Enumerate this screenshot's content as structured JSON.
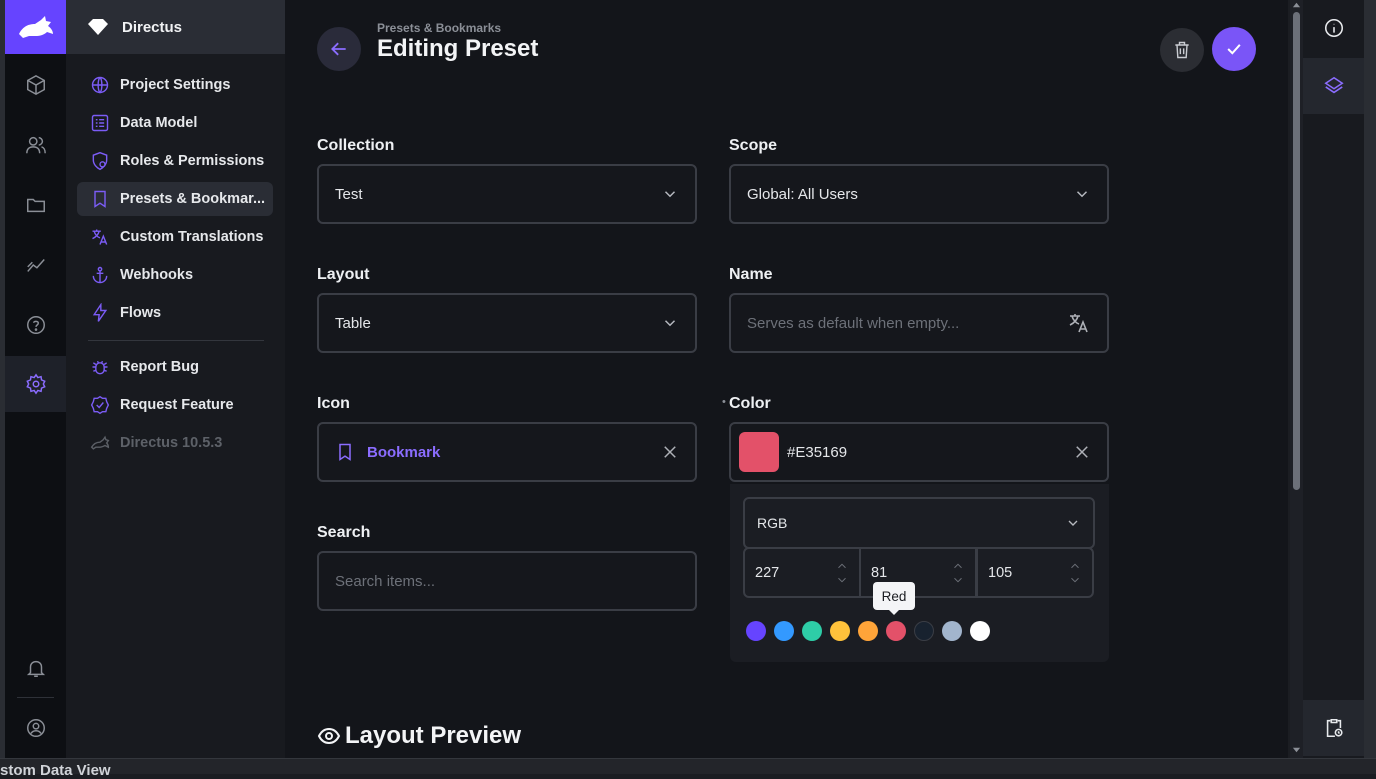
{
  "app": {
    "name": "Directus",
    "version": "Directus 10.5.3"
  },
  "colors": {
    "accent": "#6644ff",
    "selected_color": "#E35169"
  },
  "module_bar": {
    "items": [
      "content-icon",
      "users-icon",
      "files-icon",
      "insights-icon",
      "help-icon",
      "settings-icon"
    ],
    "bottom": [
      "bell-icon",
      "user-icon"
    ]
  },
  "nav": {
    "items": [
      {
        "label": "Project Settings",
        "icon": "globe-icon"
      },
      {
        "label": "Data Model",
        "icon": "list-icon"
      },
      {
        "label": "Roles & Permissions",
        "icon": "shield-icon"
      },
      {
        "label": "Presets & Bookmar...",
        "icon": "bookmark-icon"
      },
      {
        "label": "Custom Translations",
        "icon": "translate-icon"
      },
      {
        "label": "Webhooks",
        "icon": "anchor-icon"
      },
      {
        "label": "Flows",
        "icon": "bolt-icon"
      },
      {
        "label": "Report Bug",
        "icon": "bug-icon"
      },
      {
        "label": "Request Feature",
        "icon": "verified-icon"
      }
    ]
  },
  "header": {
    "breadcrumb": "Presets & Bookmarks",
    "title": "Editing Preset"
  },
  "form": {
    "collection": {
      "label": "Collection",
      "value": "Test"
    },
    "scope": {
      "label": "Scope",
      "value": "Global: All Users"
    },
    "layout": {
      "label": "Layout",
      "value": "Table"
    },
    "name": {
      "label": "Name",
      "placeholder": "Serves as default when empty..."
    },
    "icon": {
      "label": "Icon",
      "value": "Bookmark"
    },
    "color": {
      "label": "Color",
      "value": "#E35169"
    },
    "search": {
      "label": "Search",
      "placeholder": "Search items..."
    }
  },
  "color_picker": {
    "mode": "RGB",
    "r": "227",
    "g": "81",
    "b": "105",
    "tooltip": "Red",
    "presets": [
      "#6644FF",
      "#3399FF",
      "#2ECDA7",
      "#FFC23B",
      "#FFA439",
      "#E35169",
      "#18222F",
      "#A2B5CD",
      "#FFFFFF"
    ]
  },
  "section": {
    "title": "Layout Preview"
  },
  "bottom_strip": {
    "text": "stom Data View"
  }
}
